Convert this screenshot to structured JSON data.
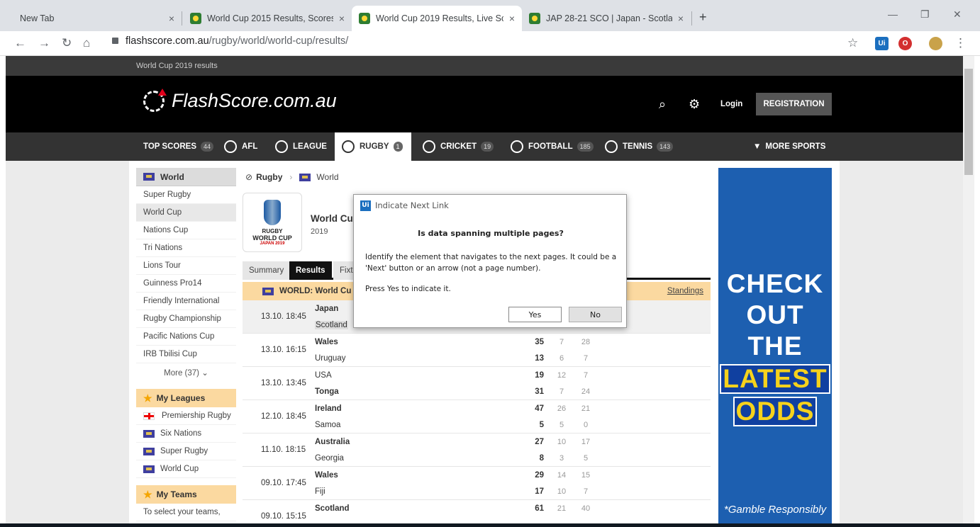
{
  "browser": {
    "tabs": [
      {
        "title": "New Tab",
        "close": "×"
      },
      {
        "title": "World Cup 2015 Results, Scores -",
        "close": "×"
      },
      {
        "title": "World Cup 2019 Results, Live Sco",
        "close": "×"
      },
      {
        "title": "JAP 28-21 SCO | Japan - Scotland",
        "close": "×"
      }
    ],
    "new_tab": "+",
    "url_domain": "flashscore.com.au",
    "url_path": "/rugby/world/world-cup/results/"
  },
  "site": {
    "top_strip": "World Cup 2019 results",
    "logo": "FlashScore.com.au",
    "login": "Login",
    "registration": "REGISTRATION"
  },
  "sport_nav": [
    {
      "label": "TOP SCORES",
      "count": "44"
    },
    {
      "label": "AFL",
      "count": ""
    },
    {
      "label": "LEAGUE",
      "count": ""
    },
    {
      "label": "RUGBY",
      "count": "1"
    },
    {
      "label": "CRICKET",
      "count": "19"
    },
    {
      "label": "FOOTBALL",
      "count": "185"
    },
    {
      "label": "TENNIS",
      "count": "143"
    },
    {
      "label": "MORE SPORTS",
      "count": ""
    }
  ],
  "sidebar": {
    "header": "World",
    "items": [
      "Super Rugby",
      "World Cup",
      "Nations Cup",
      "Tri Nations",
      "Lions Tour",
      "Guinness Pro14",
      "Friendly International",
      "Rugby Championship",
      "Pacific Nations Cup",
      "IRB Tbilisi Cup"
    ],
    "more": "More (37)",
    "my_leagues": "My Leagues",
    "leagues": [
      "Premiership Rugby",
      "Six Nations",
      "Super Rugby",
      "World Cup"
    ],
    "my_teams": "My Teams",
    "teams_hint": "To select your teams,"
  },
  "breadcrumb": {
    "sport": "Rugby",
    "region": "World"
  },
  "tournament": {
    "name": "World Cu",
    "year": "2019",
    "logo_line1": "RUGBY",
    "logo_line2": "WORLD CUP",
    "logo_line3": "JAPAN 2019"
  },
  "subtabs": [
    "Summary",
    "Results",
    "Fixt"
  ],
  "league_bar": {
    "title": "WORLD: World Cu",
    "standings": "Standings"
  },
  "matches": [
    {
      "time": "13.10. 18:45",
      "home": "Japan",
      "away": "Scotland",
      "hs": "",
      "as": "",
      "hh": "",
      "ah": "",
      "hq": "",
      "aq": ""
    },
    {
      "time": "13.10. 16:15",
      "home": "Wales",
      "away": "Uruguay",
      "hs": "35",
      "as": "13",
      "hh": "7",
      "ah": "6",
      "hq": "28",
      "aq": "7"
    },
    {
      "time": "13.10. 13:45",
      "home": "USA",
      "away": "Tonga",
      "hs": "19",
      "as": "31",
      "hh": "12",
      "ah": "7",
      "hq": "7",
      "aq": "24"
    },
    {
      "time": "12.10. 18:45",
      "home": "Ireland",
      "away": "Samoa",
      "hs": "47",
      "as": "5",
      "hh": "26",
      "ah": "5",
      "hq": "21",
      "aq": "0"
    },
    {
      "time": "11.10. 18:15",
      "home": "Australia",
      "away": "Georgia",
      "hs": "27",
      "as": "8",
      "hh": "10",
      "ah": "3",
      "hq": "17",
      "aq": "5"
    },
    {
      "time": "09.10. 17:45",
      "home": "Wales",
      "away": "Fiji",
      "hs": "29",
      "as": "17",
      "hh": "14",
      "ah": "10",
      "hq": "15",
      "aq": "7"
    },
    {
      "time": "09.10. 15:15",
      "home": "Scotland",
      "away": "",
      "hs": "61",
      "as": "",
      "hh": "21",
      "ah": "",
      "hq": "40",
      "aq": ""
    }
  ],
  "ad": {
    "line1": "CHECK",
    "line2": "OUT",
    "line3": "THE",
    "line4": "LATEST",
    "line5": "ODDS",
    "footer": "*Gamble Responsibly"
  },
  "dialog": {
    "title": "Indicate Next Link",
    "question": "Is data spanning multiple pages?",
    "body": "Identify the element that navigates to the next pages. It could be a 'Next' button or an arrow (not a page number).",
    "press": "Press Yes to indicate it.",
    "yes": "Yes",
    "no": "No"
  }
}
